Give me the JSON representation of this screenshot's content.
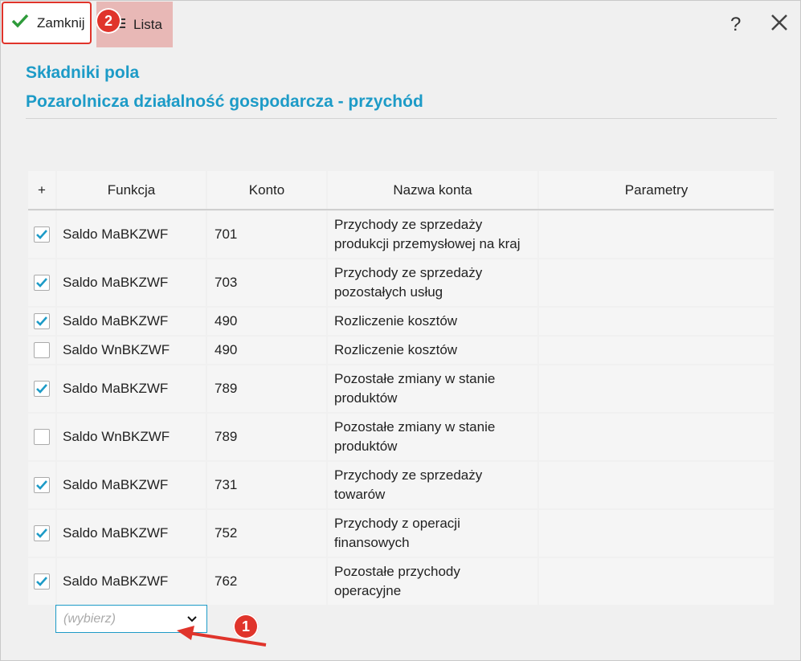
{
  "toolbar": {
    "close_label": "Zamknij",
    "list_label": "Lista",
    "list_badge": "2",
    "help_label": "?"
  },
  "header": {
    "title": "Składniki pola",
    "subtitle": "Pozarolnicza działalność gospodarcza - przychód"
  },
  "table": {
    "columns": [
      "+",
      "Funkcja",
      "Konto",
      "Nazwa konta",
      "Parametry"
    ],
    "rows": [
      {
        "checked": true,
        "funkcja": "Saldo MaBKZWF",
        "konto": "701",
        "nazwa1": "Przychody ze sprzedaży",
        "nazwa2": "produkcji przemysłowej na kraj"
      },
      {
        "checked": true,
        "funkcja": "Saldo MaBKZWF",
        "konto": "703",
        "nazwa1": "Przychody ze sprzedaży",
        "nazwa2": "pozostałych usług"
      },
      {
        "checked": true,
        "funkcja": "Saldo MaBKZWF",
        "konto": "490",
        "nazwa1": "Rozliczenie kosztów",
        "nazwa2": ""
      },
      {
        "checked": false,
        "funkcja": "Saldo WnBKZWF",
        "konto": "490",
        "nazwa1": "Rozliczenie kosztów",
        "nazwa2": ""
      },
      {
        "checked": true,
        "funkcja": "Saldo MaBKZWF",
        "konto": "789",
        "nazwa1": "Pozostałe zmiany w stanie",
        "nazwa2": "produktów"
      },
      {
        "checked": false,
        "funkcja": "Saldo WnBKZWF",
        "konto": "789",
        "nazwa1": "Pozostałe zmiany w stanie",
        "nazwa2": "produktów"
      },
      {
        "checked": true,
        "funkcja": "Saldo MaBKZWF",
        "konto": "731",
        "nazwa1": "Przychody ze sprzedaży",
        "nazwa2": "towarów"
      },
      {
        "checked": true,
        "funkcja": "Saldo MaBKZWF",
        "konto": "752",
        "nazwa1": "Przychody z operacji",
        "nazwa2": "finansowych"
      },
      {
        "checked": true,
        "funkcja": "Saldo MaBKZWF",
        "konto": "762",
        "nazwa1": "Pozostałe przychody",
        "nazwa2": "operacyjne"
      }
    ]
  },
  "select": {
    "placeholder": "(wybierz)"
  },
  "annotation": {
    "badge_1": "1"
  },
  "colors": {
    "accent": "#1d9bc7",
    "badge": "#e0342b",
    "check": "#1d9bc7",
    "close_check": "#2e9b3a"
  }
}
